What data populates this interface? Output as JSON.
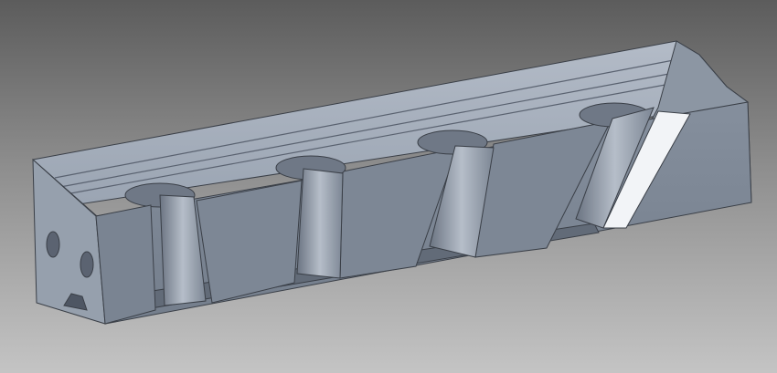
{
  "viewport": {
    "background_top": "#5c5c5c",
    "background_bottom": "#c4c4c4"
  },
  "model": {
    "face_colors": {
      "top": "#a9b2bf",
      "front": "#7e8896",
      "front_dark": "#6e7785",
      "end": "#98a1ae",
      "highlight": "#f2f4f7",
      "edge": "#3a3f47"
    },
    "counterbore_count": 4,
    "end_hole_count": 2
  }
}
